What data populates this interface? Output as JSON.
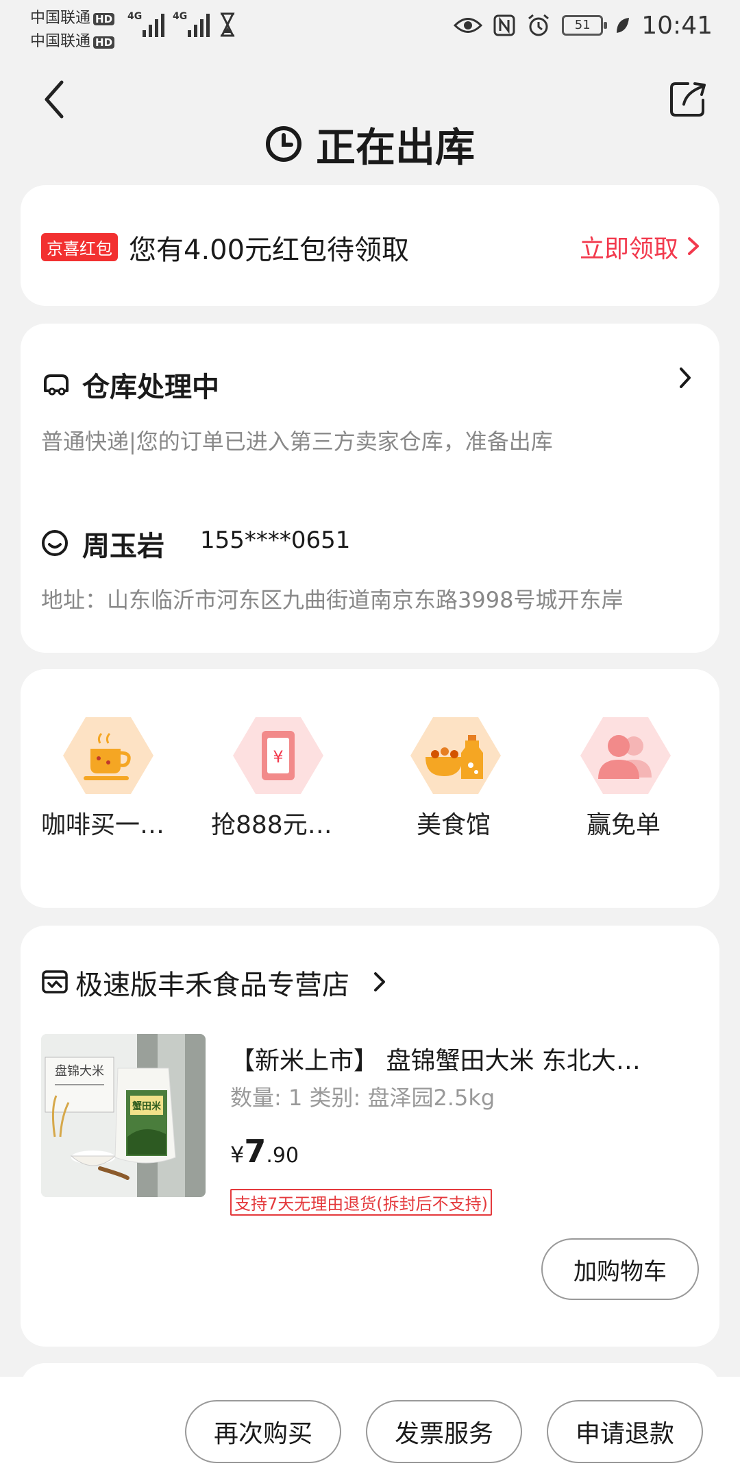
{
  "status_bar": {
    "carrier1": "中国联通",
    "carrier2": "中国联通",
    "hd": "HD",
    "network1": "4G",
    "network2": "4G",
    "battery": "51",
    "time": "10:41"
  },
  "header": {
    "title": "正在出库"
  },
  "red_packet": {
    "badge": "京喜红包",
    "text": "您有4.00元红包待领取",
    "action": "立即领取"
  },
  "order": {
    "status": "仓库处理中",
    "description": "普通快递|您的订单已进入第三方卖家仓库，准备出库",
    "recipient_name": "周玉岩",
    "recipient_phone": "155****0651",
    "address": "地址：山东临沂市河东区九曲街道南京东路3998号城开东岸"
  },
  "promos": [
    {
      "label": "咖啡买一…",
      "icon": "coffee-icon"
    },
    {
      "label": "抢888元…",
      "icon": "red-envelope-icon"
    },
    {
      "label": "美食馆",
      "icon": "food-icon"
    },
    {
      "label": "赢免单",
      "icon": "users-icon"
    }
  ],
  "product": {
    "shop_name": "极速版丰禾食品专营店",
    "title": "【新米上市】 盘锦蟹田大米 东北大…",
    "meta": "数量: 1  类别: 盘泽园2.5kg",
    "price_currency": "¥",
    "price_int": "7",
    "price_dec": ".90",
    "return_policy": "支持7天无理由退货(拆封后不支持)",
    "add_cart": "加购物车",
    "image_text_1": "盘锦大米",
    "image_text_2": "蟹田米"
  },
  "bottom_bar": {
    "rebuy": "再次购买",
    "invoice": "发票服务",
    "refund": "申请退款"
  },
  "colors": {
    "accent_red": "#f2394d",
    "badge_red": "#f23030",
    "promo_orange": "#f5a623",
    "promo_pink": "#f28a8a"
  }
}
